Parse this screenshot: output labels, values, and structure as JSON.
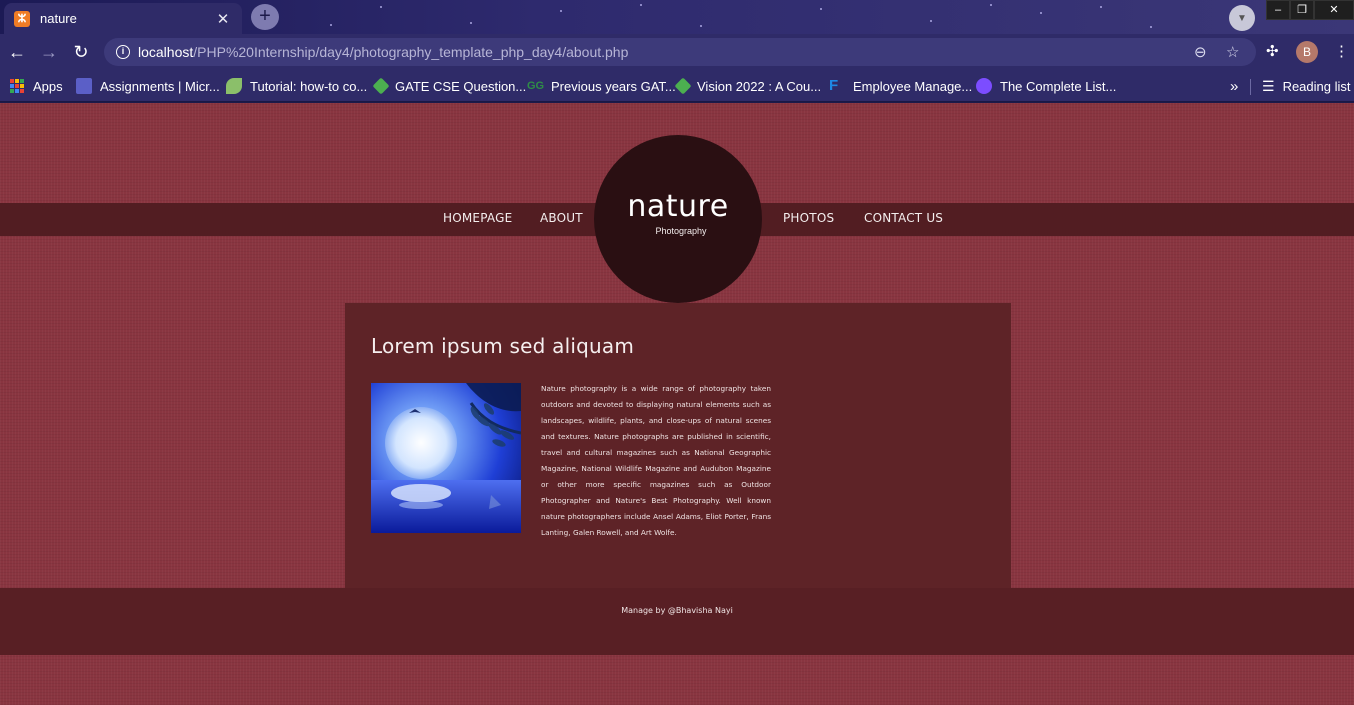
{
  "browser": {
    "tab_title": "nature",
    "tab_close": "✕",
    "new_tab": "+",
    "url_host": "localhost",
    "url_path": "/PHP%20Internship/day4/photography_template_php_day4/about.php",
    "profile_initial": "B",
    "bookmarks": [
      {
        "label": "Apps",
        "icon": "apps-grid-icon"
      },
      {
        "label": "Assignments | Micr...",
        "icon": "teams-icon",
        "color": "#5b5fc7"
      },
      {
        "label": "Tutorial: how-to co...",
        "icon": "bird-icon",
        "color": "#8bbf6a"
      },
      {
        "label": "GATE CSE Question...",
        "icon": "rocket-icon",
        "color": "#4caf50"
      },
      {
        "label": "Previous years GAT...",
        "icon": "gfg-icon",
        "color": "#2f8d46"
      },
      {
        "label": "Vision 2022 : A Cou...",
        "icon": "rocket-icon",
        "color": "#4caf50"
      },
      {
        "label": "Employee Manage...",
        "icon": "f-icon",
        "color": "#1e88e5"
      },
      {
        "label": "The Complete List...",
        "icon": "pointer-icon",
        "color": "#7c4dff"
      }
    ],
    "bookmarks_overflow": "»",
    "reading_list": "Reading list"
  },
  "site": {
    "nav": {
      "homepage": "HOMEPAGE",
      "about": "ABOUT",
      "photos": "PHOTOS",
      "contact": "CONTACT US"
    },
    "logo": {
      "main": "nature",
      "sub": "Photography"
    },
    "content": {
      "title": "Lorem ipsum sed aliquam",
      "body": "Nature photography is a wide range of photography taken outdoors and devoted to displaying natural elements such as landscapes, wildlife, plants, and close-ups of natural scenes and textures. Nature photographs are published in scientific, travel and cultural magazines such as National Geographic Magazine, National Wildlife Magazine and Audubon Magazine or other more specific magazines such as Outdoor Photographer and Nature's Best Photography. Well known nature photographers include Ansel Adams, Eliot Porter, Frans Lanting, Galen Rowell, and Art Wolfe."
    },
    "footer": "Manage by @Bhavisha Nayi"
  },
  "colors": {
    "page_bg": "#893540",
    "nav_band": "#521d22",
    "logo_circle": "#2a0f12",
    "content_box": "#5e2327",
    "footer": "#581f24",
    "browser_frame": "#2f2b68"
  }
}
